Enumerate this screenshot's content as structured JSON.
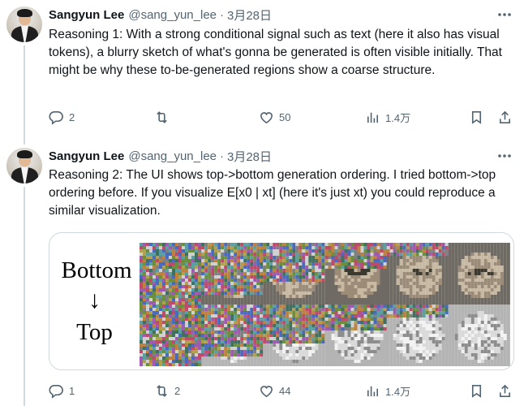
{
  "thread": [
    {
      "author": {
        "name": "Sangyun Lee",
        "handle": "@sang_yun_lee",
        "separator": "·",
        "date": "3月28日"
      },
      "text": "Reasoning 1: With a strong conditional signal such as text (here it also has visual tokens), a blurry sketch of what's gonna be generated is often visible initially. That might be why these to-be-generated regions show a coarse structure.",
      "metrics": {
        "replies": "2",
        "reposts": "",
        "likes": "50",
        "views": "1.4万"
      }
    },
    {
      "author": {
        "name": "Sangyun Lee",
        "handle": "@sang_yun_lee",
        "separator": "·",
        "date": "3月28日"
      },
      "text": "Reasoning 2: The UI shows top->bottom generation ordering. I tried bottom->top ordering before. If you visualize E[x0 | xt] (here it's just xt)  you could reproduce a similar visualization.",
      "media": {
        "label_bottom": "Bottom",
        "arrow": "↓",
        "label_top": "Top",
        "grid_columns": 6,
        "grid_rows": 2
      },
      "metrics": {
        "replies": "1",
        "reposts": "2",
        "likes": "44",
        "views": "1.4万"
      }
    }
  ],
  "icons": {
    "more": "more-horizontal-icon",
    "reply": "reply-icon",
    "repost": "repost-icon",
    "like": "heart-icon",
    "views": "analytics-icon",
    "bookmark": "bookmark-icon",
    "share": "share-icon"
  },
  "colors": {
    "text": "#0f1419",
    "secondary": "#536471",
    "border": "#cfd9de"
  }
}
